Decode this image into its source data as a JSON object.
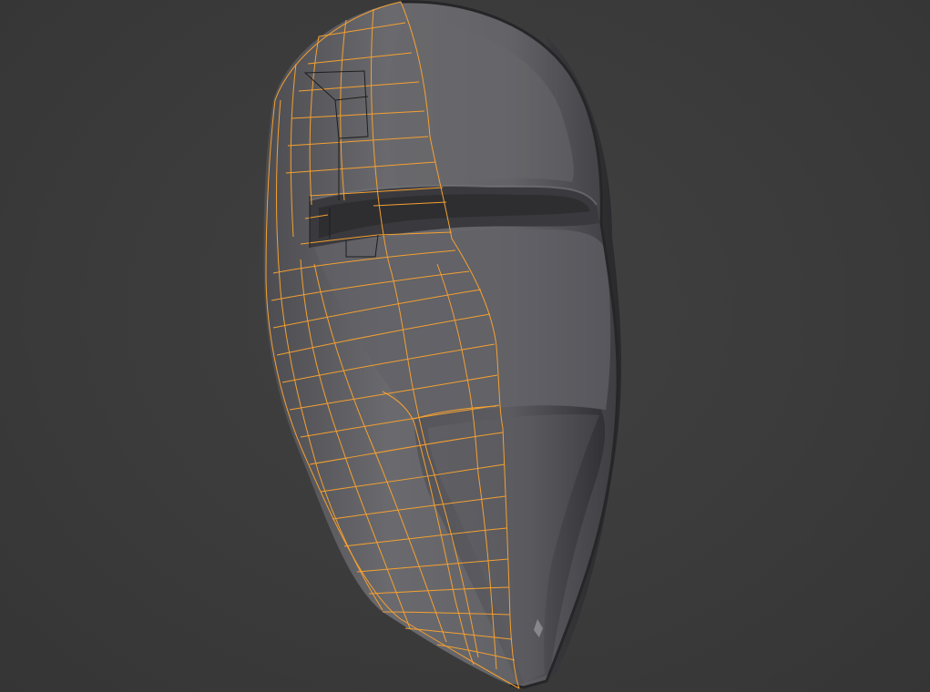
{
  "viewport": {
    "background_color": "#3c3c3c",
    "object": {
      "kind": "mask-mesh",
      "surface_color": "#5e5e62",
      "shadow_color": "#2c2c2f",
      "highlight_color": "#77777b",
      "wireframe_color": "#f5a030",
      "wireframe_inner_color": "#1e1e1e",
      "mode": "edit-mode-selected-half"
    }
  }
}
